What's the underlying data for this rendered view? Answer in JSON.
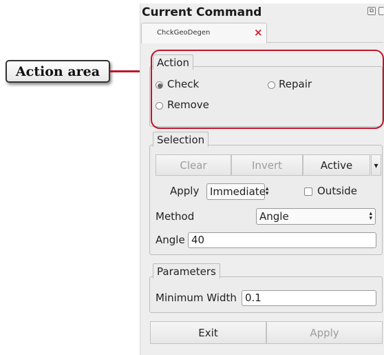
{
  "callout": {
    "label": "Action area"
  },
  "panel": {
    "title": "Current Command",
    "title_icons": [
      "float-icon",
      "close-icon"
    ],
    "tab": {
      "label": "ChckGeoDegen",
      "close": "×"
    }
  },
  "action": {
    "group_title": "Action",
    "options": [
      {
        "label": "Check",
        "selected": true
      },
      {
        "label": "Repair",
        "selected": false
      },
      {
        "label": "Remove",
        "selected": false
      }
    ]
  },
  "selection": {
    "group_title": "Selection",
    "buttons": {
      "clear": "Clear",
      "invert": "Invert",
      "active": "Active",
      "dropdown": "▾"
    },
    "apply_label": "Apply",
    "apply_value": "Immediate",
    "outside_label": "Outside",
    "outside_checked": false,
    "method_label": "Method",
    "method_value": "Angle",
    "angle_label": "Angle",
    "angle_value": "40"
  },
  "parameters": {
    "group_title": "Parameters",
    "min_width_label": "Minimum Width",
    "min_width_value": "0.1"
  },
  "footer": {
    "exit": "Exit",
    "apply": "Apply"
  },
  "colors": {
    "highlight": "#c0152a",
    "tab_close": "#d0182c"
  }
}
